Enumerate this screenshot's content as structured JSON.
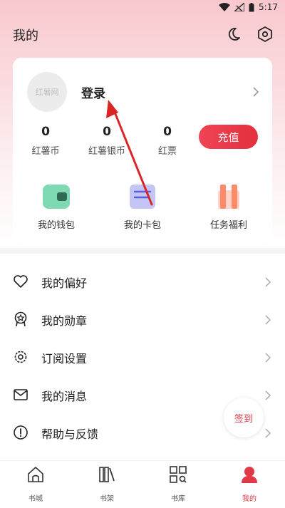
{
  "status_bar": {
    "time": "5:17"
  },
  "header": {
    "title": "我的",
    "night_icon": "moon-icon",
    "settings_icon": "hexagon-settings-icon"
  },
  "profile": {
    "avatar_text": "红薯网",
    "login_label": "登录",
    "stats": [
      {
        "value": "0",
        "label": "红薯币"
      },
      {
        "value": "0",
        "label": "红薯银币"
      },
      {
        "value": "0",
        "label": "红票"
      }
    ],
    "recharge_label": "充值"
  },
  "quick_actions": [
    {
      "label": "我的钱包",
      "icon": "wallet-icon"
    },
    {
      "label": "我的卡包",
      "icon": "card-pack-icon"
    },
    {
      "label": "任务福利",
      "icon": "gift-icon"
    }
  ],
  "menu": [
    {
      "label": "我的偏好",
      "icon": "heart-icon"
    },
    {
      "label": "我的勋章",
      "icon": "medal-icon"
    },
    {
      "label": "订阅设置",
      "icon": "gear-icon"
    },
    {
      "label": "我的消息",
      "icon": "mail-icon"
    },
    {
      "label": "帮助与反馈",
      "icon": "help-icon"
    }
  ],
  "signin_label": "签到",
  "bottom_nav": [
    {
      "label": "书城",
      "icon": "home-icon"
    },
    {
      "label": "书架",
      "icon": "bookshelf-icon"
    },
    {
      "label": "书库",
      "icon": "library-grid-icon"
    },
    {
      "label": "我的",
      "icon": "profile-icon",
      "active": true
    }
  ],
  "colors": {
    "accent": "#e03a48",
    "header_gradient_top": "#f8c8cd"
  }
}
